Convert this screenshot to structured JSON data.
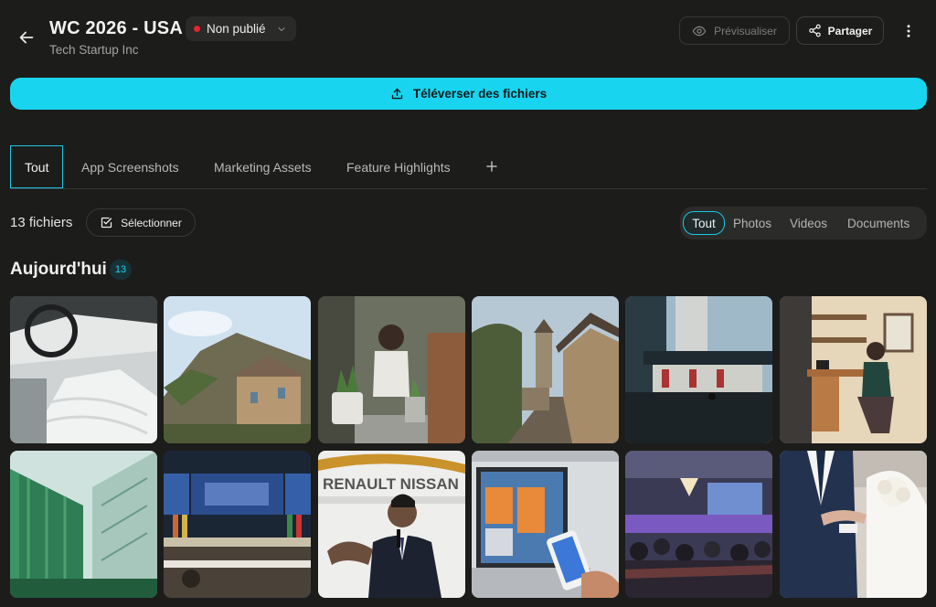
{
  "header": {
    "title": "WC 2026 - USA",
    "subtitle": "Tech Startup Inc",
    "status_label": "Non publié",
    "status_color": "#e5252f",
    "preview_label": "Prévisualiser",
    "share_label": "Partager"
  },
  "upload": {
    "label": "Téléverser des fichiers",
    "color": "#19d4ef"
  },
  "tabs": [
    {
      "label": "Tout",
      "active": true
    },
    {
      "label": "App Screenshots"
    },
    {
      "label": "Marketing Assets"
    },
    {
      "label": "Feature Highlights"
    }
  ],
  "toolbar": {
    "count_label": "13 fichiers",
    "select_label": "Sélectionner"
  },
  "filters": [
    {
      "label": "Tout",
      "active": true
    },
    {
      "label": "Photos"
    },
    {
      "label": "Videos"
    },
    {
      "label": "Documents"
    }
  ],
  "section": {
    "title": "Aujourd'hui",
    "count": "13"
  },
  "gallery": [
    {
      "name": "car-interior-photo"
    },
    {
      "name": "village-cliff-photo"
    },
    {
      "name": "woman-plants-photo"
    },
    {
      "name": "old-street-photo"
    },
    {
      "name": "glass-building-photo"
    },
    {
      "name": "home-office-photo"
    },
    {
      "name": "green-architecture-photo"
    },
    {
      "name": "conference-hall-photo"
    },
    {
      "name": "speaker-renault-nissan-photo"
    },
    {
      "name": "laptop-phone-photo"
    },
    {
      "name": "event-audience-photo"
    },
    {
      "name": "wedding-couple-photo"
    }
  ],
  "icons": {
    "back": "arrow-left-icon",
    "preview": "eye-icon",
    "share": "share-icon",
    "more": "more-vertical-icon",
    "upload": "upload-icon",
    "select": "checkbox-icon",
    "add_tab": "plus-icon"
  },
  "logo_text": {
    "banner": "RENAULT NISSAN"
  }
}
